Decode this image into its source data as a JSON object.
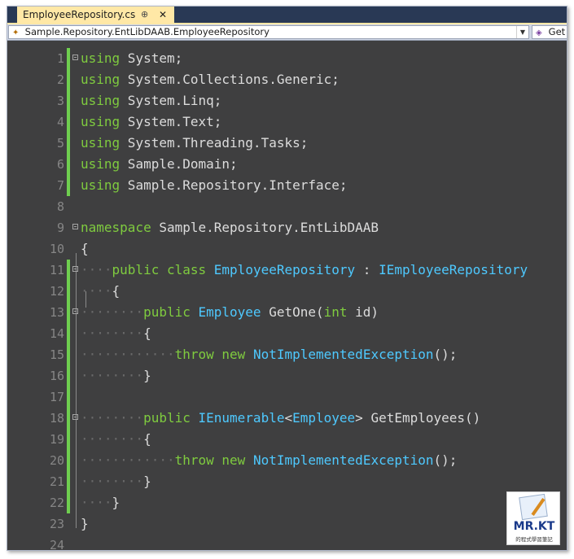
{
  "tab": {
    "title": "EmployeeRepository.cs",
    "pin": "⊕",
    "close": "✕"
  },
  "navigation": {
    "type_path": "Sample.Repository.EntLibDAAB.EmployeeRepository",
    "member": "Get"
  },
  "lines": [
    {
      "number": "1",
      "tokens": [
        [
          "kw",
          "using"
        ],
        [
          "txt",
          " System;"
        ]
      ]
    },
    {
      "number": "2",
      "tokens": [
        [
          "kw",
          "using"
        ],
        [
          "txt",
          " System.Collections.Generic;"
        ]
      ]
    },
    {
      "number": "3",
      "tokens": [
        [
          "kw",
          "using"
        ],
        [
          "txt",
          " System.Linq;"
        ]
      ]
    },
    {
      "number": "4",
      "tokens": [
        [
          "kw",
          "using"
        ],
        [
          "txt",
          " System.Text;"
        ]
      ]
    },
    {
      "number": "5",
      "tokens": [
        [
          "kw",
          "using"
        ],
        [
          "txt",
          " System.Threading.Tasks;"
        ]
      ]
    },
    {
      "number": "6",
      "tokens": [
        [
          "kw",
          "using"
        ],
        [
          "txt",
          " Sample.Domain;"
        ]
      ]
    },
    {
      "number": "7",
      "tokens": [
        [
          "kw",
          "using"
        ],
        [
          "txt",
          " Sample.Repository.Interface;"
        ]
      ]
    },
    {
      "number": "8",
      "tokens": []
    },
    {
      "number": "9",
      "tokens": [
        [
          "kw",
          "namespace"
        ],
        [
          "txt",
          " Sample.Repository.EntLibDAAB"
        ]
      ]
    },
    {
      "number": "10",
      "tokens": [
        [
          "txt",
          "{"
        ]
      ]
    },
    {
      "number": "11",
      "tokens": [
        [
          "ws",
          "····"
        ],
        [
          "kw",
          "public"
        ],
        [
          "txt",
          " "
        ],
        [
          "kw",
          "class"
        ],
        [
          "txt",
          " "
        ],
        [
          "ty",
          "EmployeeRepository"
        ],
        [
          "txt",
          " : "
        ],
        [
          "ty",
          "IEmployeeRepository"
        ]
      ]
    },
    {
      "number": "12",
      "tokens": [
        [
          "ws",
          "····"
        ],
        [
          "txt",
          "{"
        ]
      ]
    },
    {
      "number": "13",
      "tokens": [
        [
          "ws",
          "········"
        ],
        [
          "kw",
          "public"
        ],
        [
          "txt",
          " "
        ],
        [
          "ty",
          "Employee"
        ],
        [
          "txt",
          " GetOne("
        ],
        [
          "kw",
          "int"
        ],
        [
          "txt",
          " id)"
        ]
      ]
    },
    {
      "number": "14",
      "tokens": [
        [
          "ws",
          "········"
        ],
        [
          "txt",
          "{"
        ]
      ]
    },
    {
      "number": "15",
      "tokens": [
        [
          "ws",
          "············"
        ],
        [
          "kw",
          "throw"
        ],
        [
          "txt",
          " "
        ],
        [
          "kw",
          "new"
        ],
        [
          "txt",
          " "
        ],
        [
          "ty",
          "NotImplementedException"
        ],
        [
          "txt",
          "();"
        ]
      ]
    },
    {
      "number": "16",
      "tokens": [
        [
          "ws",
          "········"
        ],
        [
          "txt",
          "}"
        ]
      ]
    },
    {
      "number": "17",
      "tokens": []
    },
    {
      "number": "18",
      "tokens": [
        [
          "ws",
          "········"
        ],
        [
          "kw",
          "public"
        ],
        [
          "txt",
          " "
        ],
        [
          "ty",
          "IEnumerable"
        ],
        [
          "txt",
          "<"
        ],
        [
          "ty",
          "Employee"
        ],
        [
          "txt",
          "> GetEmployees()"
        ]
      ]
    },
    {
      "number": "19",
      "tokens": [
        [
          "ws",
          "········"
        ],
        [
          "txt",
          "{"
        ]
      ]
    },
    {
      "number": "20",
      "tokens": [
        [
          "ws",
          "············"
        ],
        [
          "kw",
          "throw"
        ],
        [
          "txt",
          " "
        ],
        [
          "kw",
          "new"
        ],
        [
          "txt",
          " "
        ],
        [
          "ty",
          "NotImplementedException"
        ],
        [
          "txt",
          "();"
        ]
      ]
    },
    {
      "number": "21",
      "tokens": [
        [
          "ws",
          "········"
        ],
        [
          "txt",
          "}"
        ]
      ]
    },
    {
      "number": "22",
      "tokens": [
        [
          "ws",
          "····"
        ],
        [
          "txt",
          "}"
        ]
      ]
    },
    {
      "number": "23",
      "tokens": [
        [
          "txt",
          "}"
        ]
      ]
    },
    {
      "number": "24",
      "tokens": []
    }
  ],
  "changed_lines": [
    "1",
    "2",
    "3",
    "4",
    "5",
    "6",
    "7",
    "11",
    "12",
    "13",
    "14",
    "15",
    "16",
    "17",
    "18",
    "19",
    "20",
    "21",
    "22"
  ],
  "fold_lines": [
    "1",
    "9",
    "11",
    "13",
    "18"
  ],
  "watermark": {
    "title": "MR.KT",
    "subtitle": "的程式學習筆記"
  },
  "colors": {
    "keyword": "#7fcb3f",
    "type": "#4ec9ff",
    "text": "#dcdcdc",
    "line_number": "#868686",
    "change_bar": "#6fcf4f",
    "background": "#3f3f40",
    "tab_active": "#ffe8a6"
  }
}
